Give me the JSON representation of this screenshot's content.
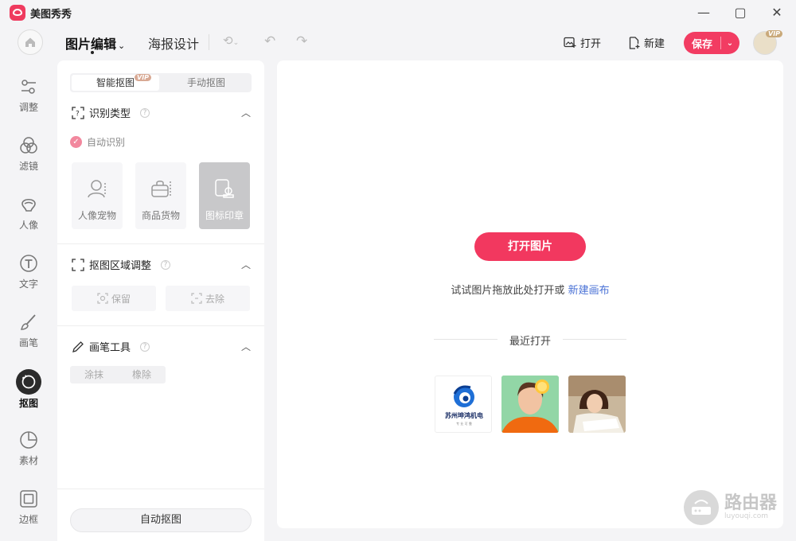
{
  "window": {
    "title": "美图秀秀",
    "controls": {
      "minimize": "—",
      "maximize": "▢",
      "close": "✕"
    }
  },
  "header": {
    "tabs": [
      {
        "label": "图片编辑",
        "active": true
      },
      {
        "label": "海报设计",
        "active": false
      }
    ],
    "open_label": "打开",
    "new_label": "新建",
    "save_label": "保存",
    "vip_badge": "VIP"
  },
  "rail": {
    "items": [
      {
        "label": "调整",
        "icon": "sliders-icon",
        "active": false
      },
      {
        "label": "滤镜",
        "icon": "filter-circles-icon",
        "active": false
      },
      {
        "label": "人像",
        "icon": "portrait-icon",
        "active": false
      },
      {
        "label": "文字",
        "icon": "text-icon",
        "active": false
      },
      {
        "label": "画笔",
        "icon": "brush-icon",
        "active": false
      },
      {
        "label": "抠图",
        "icon": "cutout-icon",
        "active": true
      },
      {
        "label": "素材",
        "icon": "sticker-icon",
        "active": false
      },
      {
        "label": "边框",
        "icon": "frame-icon",
        "active": false
      }
    ]
  },
  "panel": {
    "segment": {
      "smart": "智能抠图",
      "manual": "手动抠图",
      "vip": "VIP"
    },
    "recognize": {
      "title": "识别类型",
      "auto_label": "自动识别",
      "types": [
        {
          "label": "人像宠物",
          "icon": "person-pet-icon",
          "selected": false
        },
        {
          "label": "商品货物",
          "icon": "product-bag-icon",
          "selected": false
        },
        {
          "label": "图标印章",
          "icon": "stamp-icon",
          "selected": true
        }
      ]
    },
    "region": {
      "title": "抠图区域调整",
      "keep_label": "保留",
      "remove_label": "去除"
    },
    "brush": {
      "title": "画笔工具",
      "smear_label": "涂抹",
      "eraser_label": "橡除"
    },
    "auto_button": "自动抠图"
  },
  "canvas": {
    "open_button": "打开图片",
    "hint_text": "试试图片拖放此处打开或",
    "hint_link": "新建画布",
    "recent_title": "最近打开",
    "recent": [
      {
        "caption": "苏州坤鸿机电",
        "sub": "专 业 可 靠"
      },
      {
        "caption": ""
      },
      {
        "caption": ""
      }
    ]
  },
  "watermark": {
    "title": "路由器",
    "sub": "luyouqi.com"
  },
  "colors": {
    "accent": "#f2385f",
    "link": "#4a72d6",
    "panel_bg": "#f4f4f6"
  }
}
